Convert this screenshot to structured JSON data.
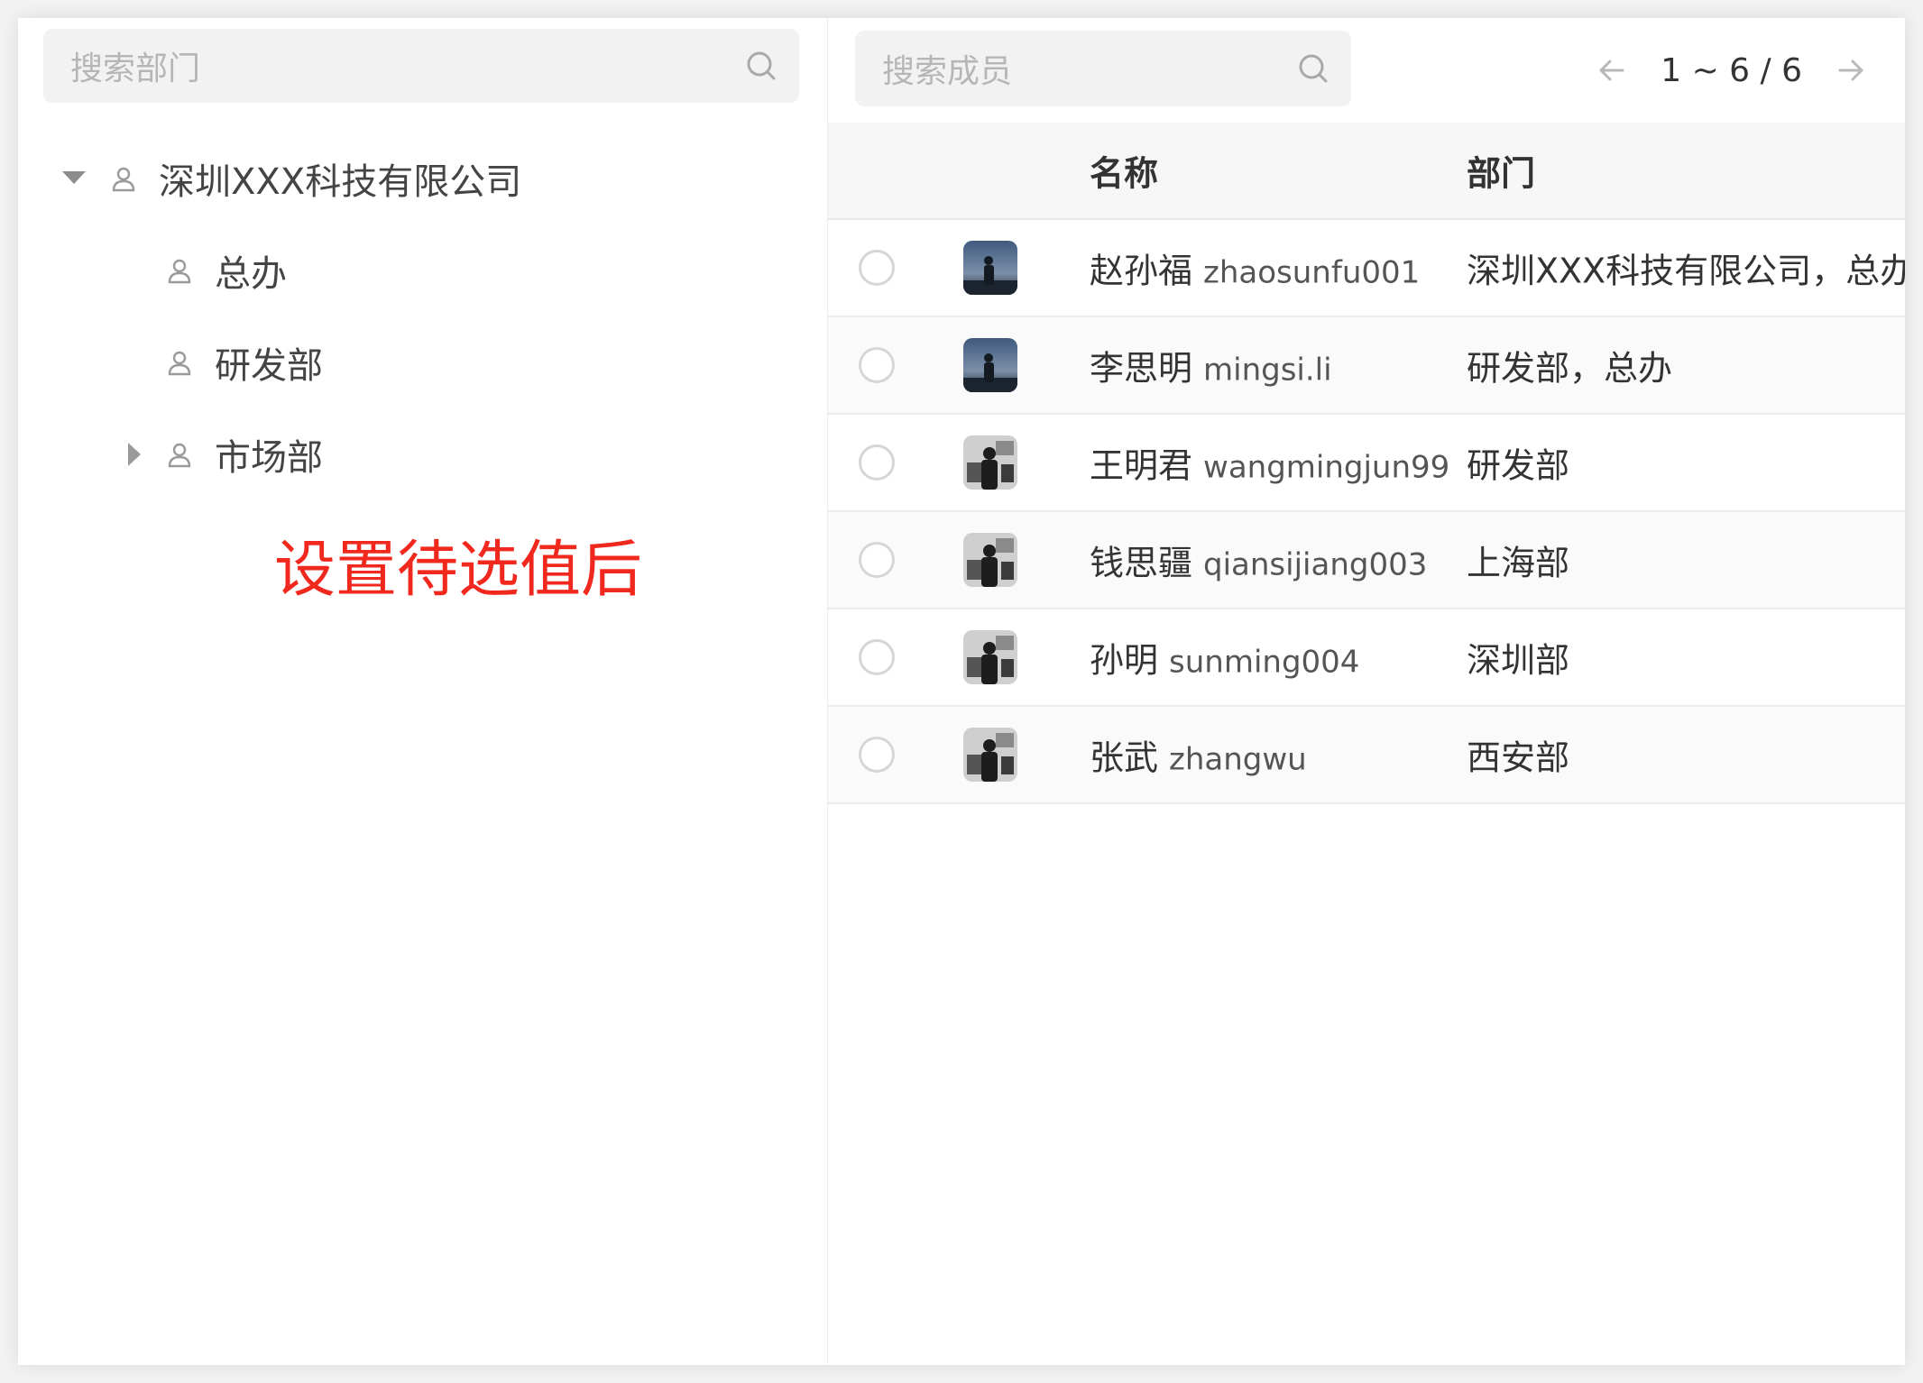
{
  "dept_panel": {
    "search_placeholder": "搜索部门",
    "tree": [
      {
        "label": "深圳XXX科技有限公司",
        "state": "expanded"
      },
      {
        "label": "总办",
        "state": "leaf"
      },
      {
        "label": "研发部",
        "state": "leaf"
      },
      {
        "label": "市场部",
        "state": "collapsed"
      }
    ],
    "note": "设置待选值后"
  },
  "member_panel": {
    "search_placeholder": "搜索成员",
    "pagination": "1 ~ 6 / 6",
    "columns": {
      "name": "名称",
      "dept": "部门"
    },
    "rows": [
      {
        "name": "赵孙福",
        "username": "zhaosunfu001",
        "dept": "深圳XXX科技有限公司，总办",
        "avatar": "silhouette-sky",
        "selected": false
      },
      {
        "name": "李思明",
        "username": "mingsi.li",
        "dept": "研发部，总办",
        "avatar": "silhouette-sky",
        "selected": false
      },
      {
        "name": "王明君",
        "username": "wangmingjun99",
        "dept": "研发部",
        "avatar": "silhouette-bw",
        "selected": false
      },
      {
        "name": "钱思疆",
        "username": "qiansijiang003",
        "dept": "上海部",
        "avatar": "silhouette-bw",
        "selected": false
      },
      {
        "name": "孙明",
        "username": "sunming004",
        "dept": "深圳部",
        "avatar": "silhouette-bw",
        "selected": false
      },
      {
        "name": "张武",
        "username": "zhangwu",
        "dept": "西安部",
        "avatar": "silhouette-bw",
        "selected": false
      }
    ]
  },
  "colors": {
    "note_red": "#f0281e",
    "header_bg": "#f7f7f7",
    "search_bg": "#f2f2f2"
  }
}
